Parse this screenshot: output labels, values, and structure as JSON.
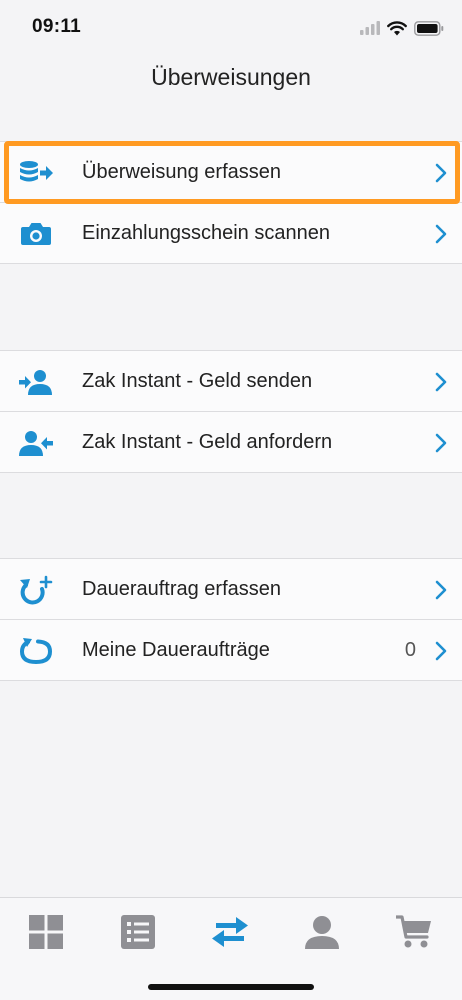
{
  "status_bar": {
    "time": "09:11"
  },
  "header": {
    "title": "Überweisungen"
  },
  "groups": [
    {
      "items": [
        {
          "label": "Überweisung erfassen",
          "icon": "coins-transfer-icon",
          "highlighted": true
        },
        {
          "label": "Einzahlungsschein scannen",
          "icon": "camera-icon"
        }
      ]
    },
    {
      "items": [
        {
          "label": "Zak Instant - Geld senden",
          "icon": "person-send-icon"
        },
        {
          "label": "Zak Instant - Geld anfordern",
          "icon": "person-request-icon"
        }
      ]
    },
    {
      "items": [
        {
          "label": "Dauerauftrag erfassen",
          "icon": "recurring-add-icon"
        },
        {
          "label": "Meine Daueraufträge",
          "icon": "recurring-icon",
          "count": "0"
        }
      ]
    }
  ],
  "tabbar": {
    "tabs": [
      {
        "icon": "dashboard-grid-icon",
        "active": false
      },
      {
        "icon": "list-icon",
        "active": false
      },
      {
        "icon": "transfer-arrows-icon",
        "active": true
      },
      {
        "icon": "profile-icon",
        "active": false
      },
      {
        "icon": "cart-icon",
        "active": false
      }
    ]
  },
  "colors": {
    "accent_blue": "#1e8fd0",
    "highlight_orange": "#ff9a22",
    "inactive_gray": "#8f8f94"
  }
}
